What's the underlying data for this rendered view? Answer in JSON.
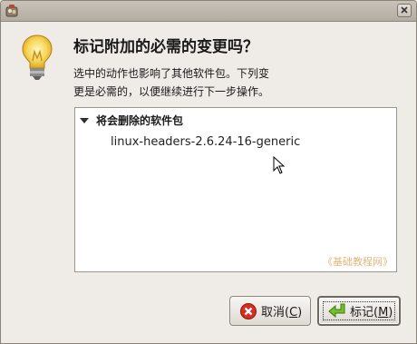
{
  "dialog": {
    "heading": "标记附加的必需的变更吗？",
    "desc_line1": "选中的动作也影响了其他软件包。下列变",
    "desc_line2": "更是必需的，以便继续进行下一步操作。"
  },
  "changes": {
    "group_label": "将会删除的软件包",
    "packages": [
      "linux-headers-2.6.24-16-generic"
    ],
    "watermark": "《基础教程网》"
  },
  "buttons": {
    "cancel_label": "取消(",
    "cancel_mnemonic": "C",
    "cancel_close": ")",
    "ok_label": "标记(",
    "ok_mnemonic": "M",
    "ok_close": ")"
  },
  "colors": {
    "window_bg": "#efebe7",
    "watermark": "#e0b77e",
    "cancel_icon": "#d62d20",
    "ok_icon": "#4e9a06"
  },
  "icons": {
    "title": "app-icon",
    "close": "close-icon",
    "hint": "light-bulb-icon",
    "expander": "expander-down-icon",
    "cancel": "cancel-icon",
    "ok": "ok-arrow-icon"
  }
}
